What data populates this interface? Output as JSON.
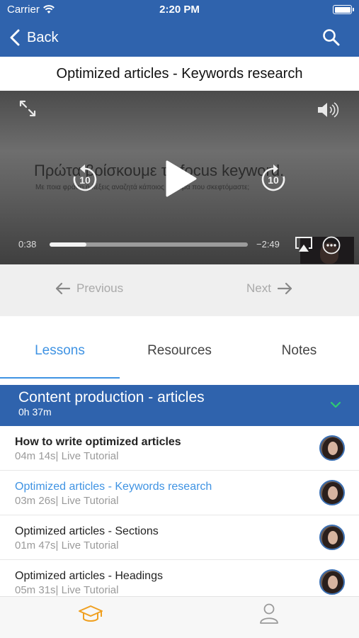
{
  "status_bar": {
    "carrier": "Carrier",
    "time": "2:20 PM"
  },
  "nav": {
    "back_label": "Back"
  },
  "lesson_title": "Optimized articles - Keywords research",
  "player": {
    "slide_text": "Πρώτα βρίσκουμε το focus keyword.",
    "slide_subtext": "Με ποια φράση ή λέξεις αναζητά κάποιος το θέμα που σκεφτόμαστε;",
    "rewind_label": "10",
    "forward_label": "10",
    "elapsed": "0:38",
    "remaining": "−2:49",
    "progress": 0.185
  },
  "navigation": {
    "previous_label": "Previous",
    "next_label": "Next"
  },
  "tabs": [
    {
      "label": "Lessons"
    },
    {
      "label": "Resources"
    },
    {
      "label": "Notes"
    }
  ],
  "section": {
    "title": "Content production - articles",
    "duration": "0h 37m"
  },
  "lessons": [
    {
      "title": "How to write optimized articles",
      "meta": "04m 14s| Live Tutorial"
    },
    {
      "title": "Optimized articles - Keywords research",
      "meta": "03m 26s| Live Tutorial"
    },
    {
      "title": "Optimized articles - Sections",
      "meta": "01m 47s| Live Tutorial"
    },
    {
      "title": "Optimized articles - Headings",
      "meta": "05m 31s| Live Tutorial"
    }
  ],
  "colors": {
    "brand_blue": "#2f63ad",
    "accent_blue": "#3f93e3",
    "tabbar_active": "#f0a020",
    "tabbar_inactive": "#9a9a9a",
    "chevron_green": "#2ecc71"
  },
  "icons": {
    "nav": [
      "back-chevron-icon",
      "search-icon"
    ],
    "player": [
      "fullscreen-icon",
      "volume-icon",
      "rewind-10-icon",
      "play-icon",
      "forward-10-icon",
      "airplay-icon",
      "more-icon"
    ],
    "tabbar": [
      "graduation-cap-icon",
      "person-icon"
    ]
  }
}
